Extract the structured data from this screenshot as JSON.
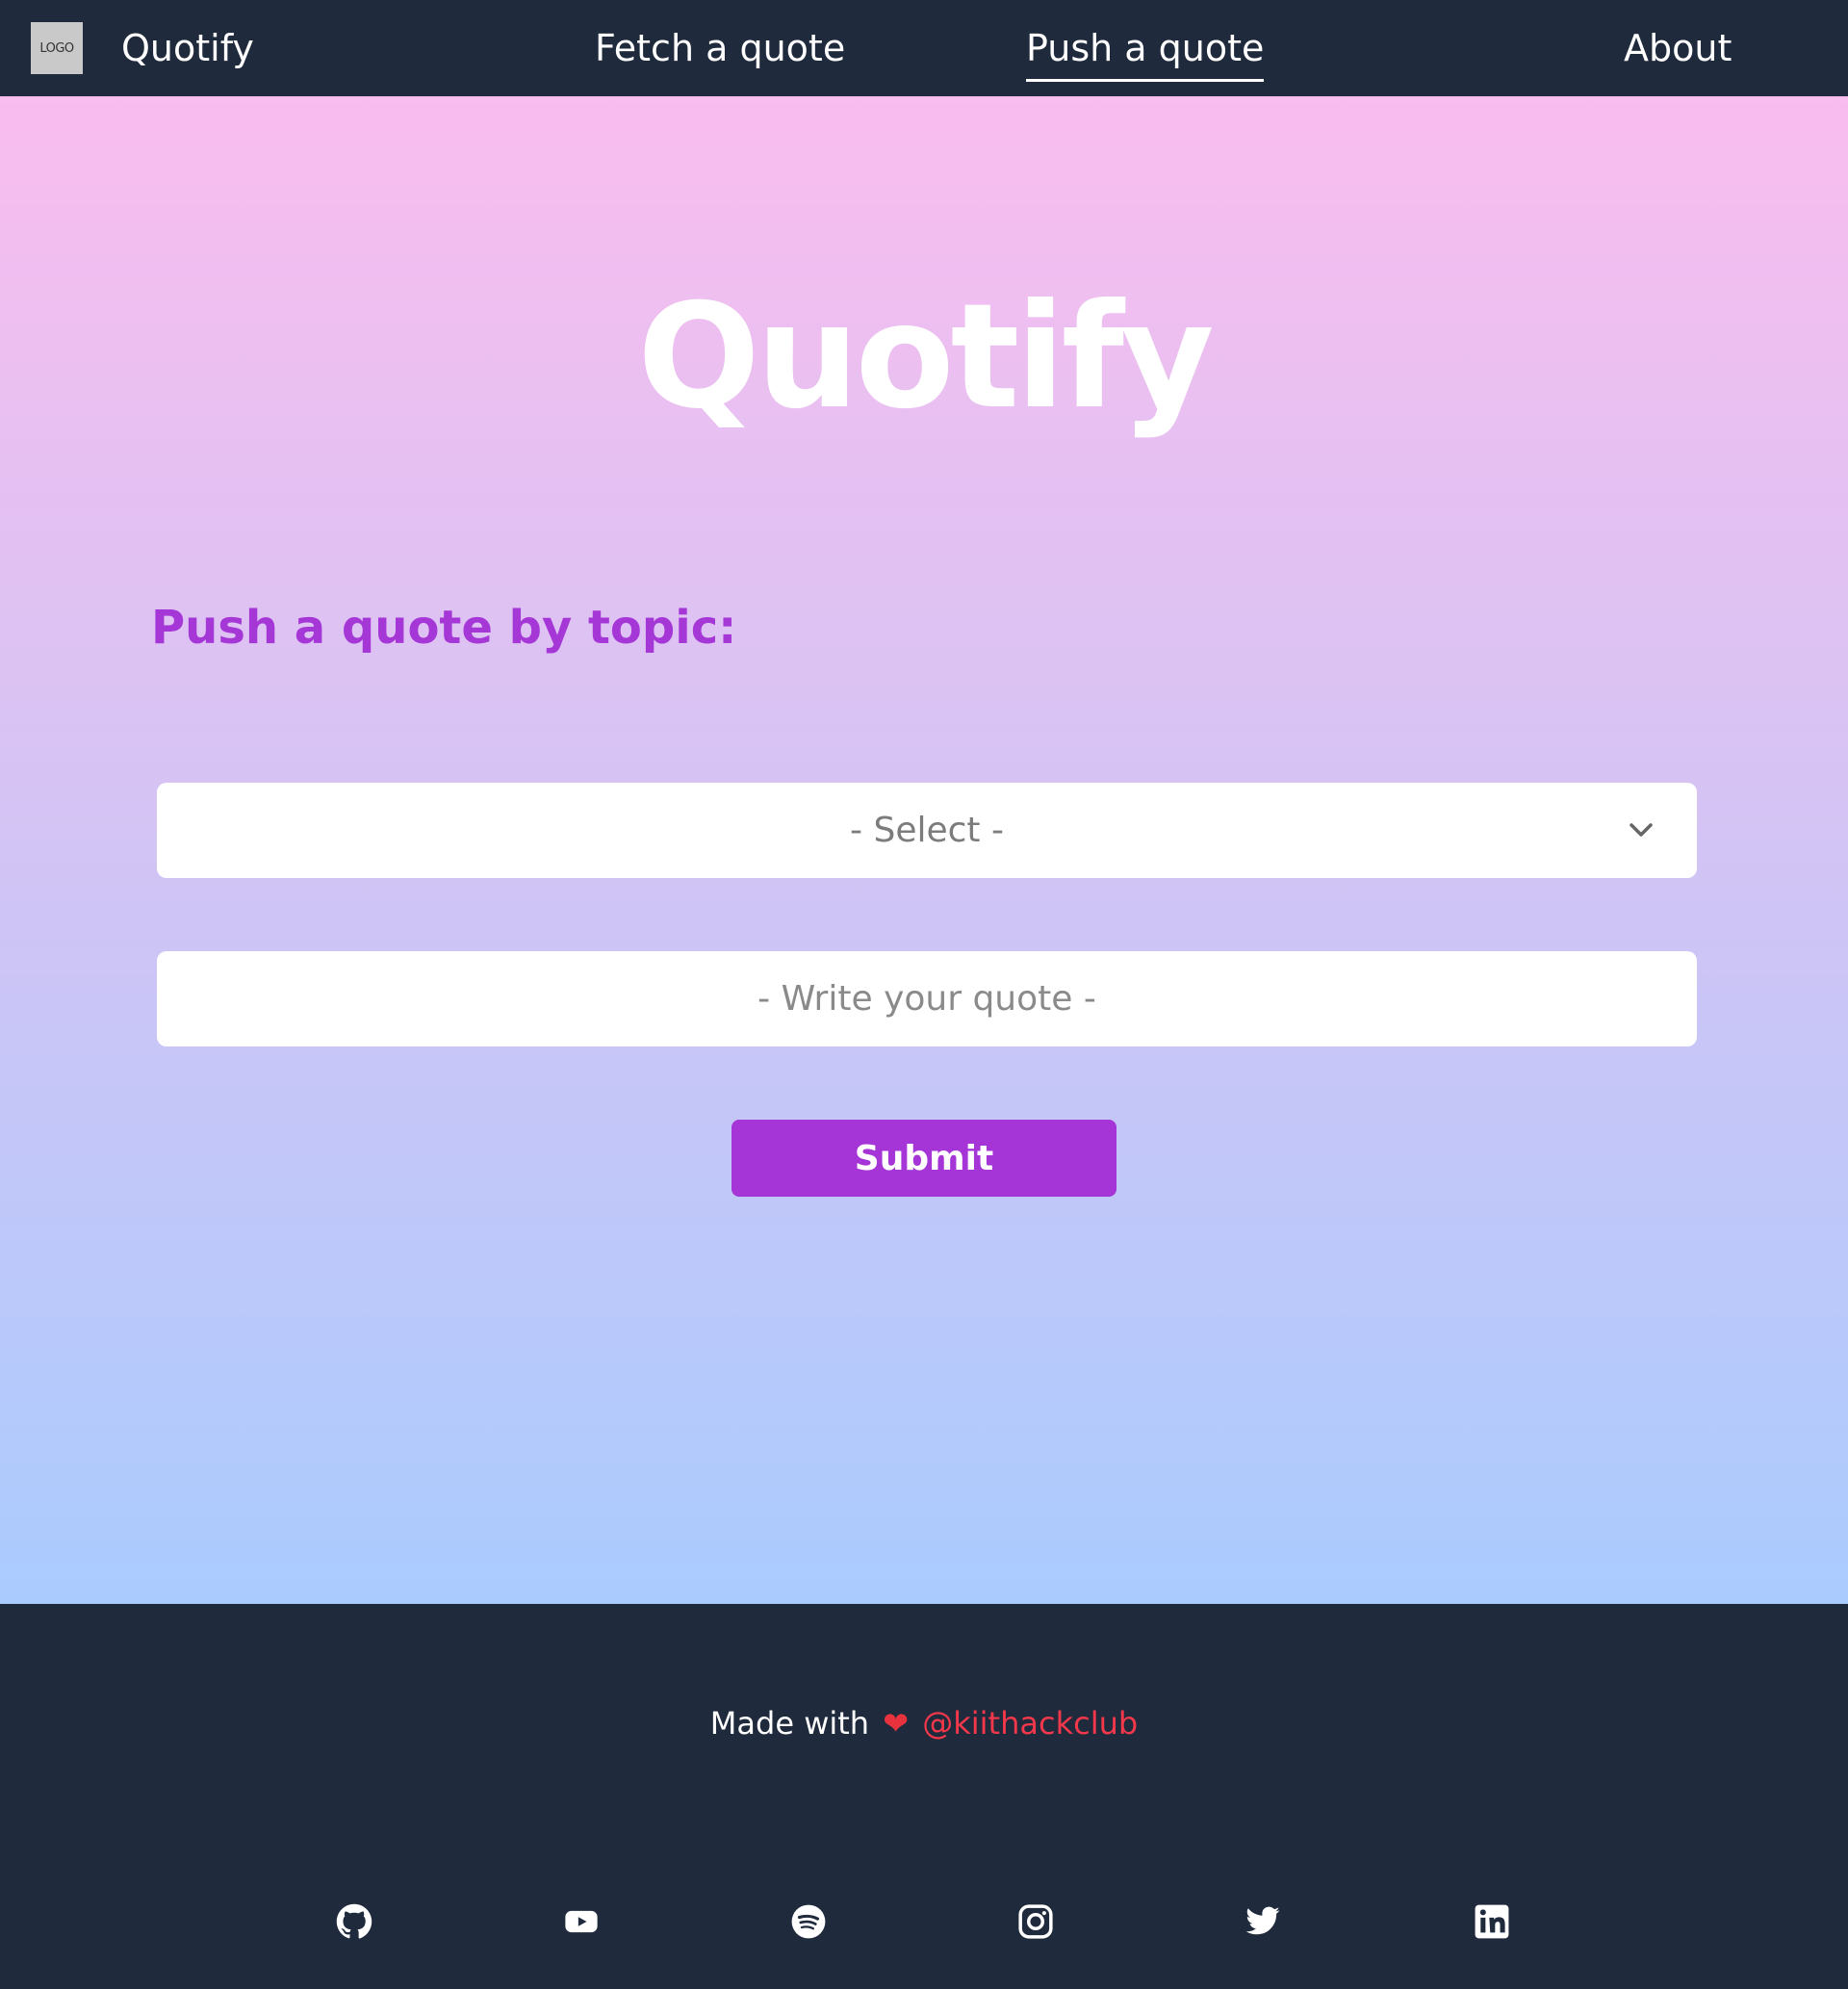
{
  "navbar": {
    "logo_text": "LOGO",
    "brand": "Quotify",
    "links": [
      {
        "label": "Fetch a quote"
      },
      {
        "label": "Push a quote"
      },
      {
        "label": "About"
      }
    ],
    "active_link": "Push a quote"
  },
  "main": {
    "hero_title": "Quotify",
    "section_heading": "Push a quote by topic:",
    "select": {
      "value": "- Select -",
      "icon": "chevron-down-icon"
    },
    "quote_input": {
      "placeholder": "- Write your quote -",
      "value": ""
    },
    "submit_label": "Submit"
  },
  "footer": {
    "made_with": "Made with",
    "heart": "❤",
    "handle": "@kiithackclub",
    "socials": [
      {
        "icon": "github-icon"
      },
      {
        "icon": "youtube-icon"
      },
      {
        "icon": "spotify-icon"
      },
      {
        "icon": "instagram-icon"
      },
      {
        "icon": "twitter-icon"
      },
      {
        "icon": "linkedin-icon"
      }
    ]
  },
  "colors": {
    "nav_bg": "#1f2a3c",
    "gradient_top": "#f9bdee",
    "gradient_bottom": "#aacbfe",
    "accent_purple": "#a637d7",
    "handle_red": "#f2384a"
  }
}
